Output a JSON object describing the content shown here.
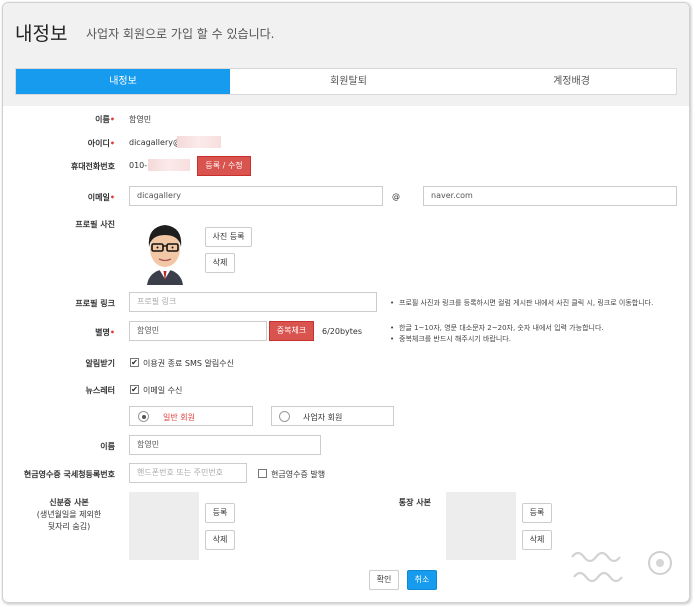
{
  "header": {
    "title": "내정보",
    "subtitle": "사업자 회원으로 가입 할 수 있습니다."
  },
  "tabs": [
    {
      "label": "내정보",
      "active": true
    },
    {
      "label": "회원탈퇴",
      "active": false
    },
    {
      "label": "계정배경",
      "active": false
    }
  ],
  "form": {
    "name": {
      "label": "이름",
      "value": "함영민"
    },
    "userid": {
      "label": "아이디",
      "value": "dicagallery@"
    },
    "phone": {
      "label": "휴대전화번호",
      "value": "010-",
      "button": "등록 / 수정"
    },
    "email": {
      "label": "이메일",
      "local": "dicagallery",
      "at": "@",
      "domain": "naver.com"
    },
    "photo": {
      "label": "프로필 사진",
      "register": "사진 등록",
      "delete": "삭제"
    },
    "link": {
      "label": "프로필 링크",
      "placeholder": "프로필 링크",
      "note": "프로필 사진과 링크를 등록하시면 컬럼 게시판 내에서 사진 클릭 시, 링크로 이동합니다."
    },
    "nickname": {
      "label": "별명",
      "value": "함영민",
      "button": "중복체크",
      "count": "6/20bytes",
      "note1": "한글 1~10자, 영문 대소문자 2~20자, 숫자 내에서 입력 가능합니다.",
      "note2": "중복체크를 반드시 해주시기 바랍니다."
    },
    "alert": {
      "label": "알림받기",
      "option": "이용권 종료 SMS 알림수신",
      "checked": true
    },
    "newsletter": {
      "label": "뉴스레터",
      "option": "이메일 수신",
      "checked": true
    },
    "member_type": {
      "general": "일반 회원",
      "business": "사업자 회원",
      "selected": "general"
    },
    "name2": {
      "label": "이름",
      "value": "함영민"
    },
    "receipt": {
      "label": "현금영수증 국세청등록번호",
      "placeholder": "핸드폰번호 또는 주민번호",
      "option": "현금영수증 발행",
      "checked": false
    },
    "id_copy": {
      "label_line1": "신분증 사본",
      "label_line2": "(생년월일을 제외한",
      "label_line3": "뒷자리 숨김)",
      "register": "등록",
      "delete": "삭제"
    },
    "bankbook": {
      "label": "통장 사본",
      "register": "등록",
      "delete": "삭제"
    }
  },
  "actions": {
    "confirm": "확인",
    "cancel": "취소"
  },
  "colors": {
    "accent": "#169bef",
    "danger": "#d9534f",
    "required": "#e23b3b"
  }
}
